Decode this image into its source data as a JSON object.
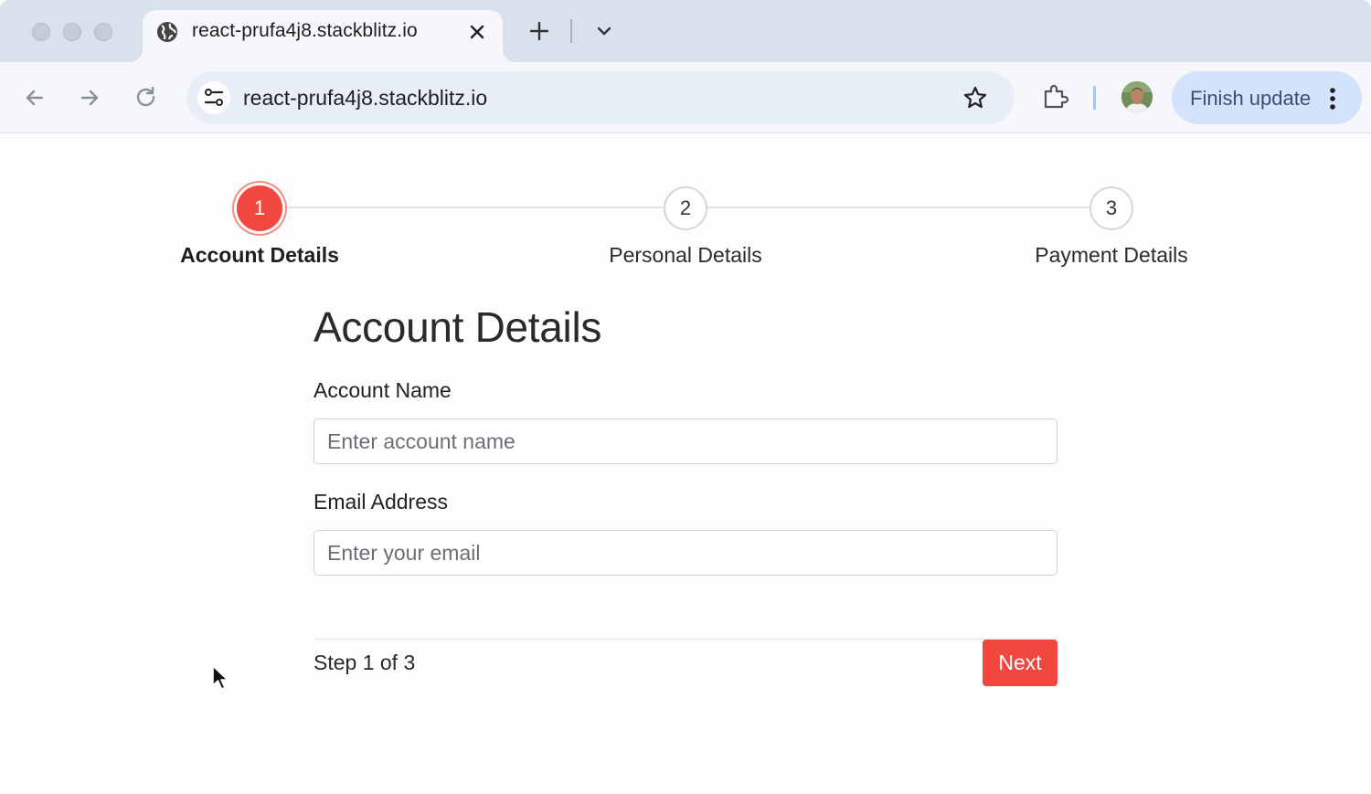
{
  "browser": {
    "tab": {
      "title": "react-prufa4j8.stackblitz.io"
    },
    "address_bar": {
      "url": "react-prufa4j8.stackblitz.io"
    },
    "update_button": {
      "label": "Finish update"
    },
    "colors": {
      "toolbar": "#f5f7fb",
      "tabstrip": "#d9e1ec",
      "update": "#d3e3fd"
    }
  },
  "stepper": {
    "active_step": 1,
    "steps": [
      {
        "number": "1",
        "label": "Account Details"
      },
      {
        "number": "2",
        "label": "Personal Details"
      },
      {
        "number": "3",
        "label": "Payment Details"
      }
    ]
  },
  "form": {
    "title": "Account Details",
    "fields": [
      {
        "label": "Account Name",
        "placeholder": "Enter account name",
        "value": ""
      },
      {
        "label": "Email Address",
        "placeholder": "Enter your email",
        "value": ""
      }
    ]
  },
  "footer": {
    "step_text": "Step 1 of 3",
    "next_label": "Next"
  },
  "colors": {
    "accent": "#f2473f"
  },
  "icons": [
    "globe-icon",
    "close-icon",
    "plus-icon",
    "chevron-down-icon",
    "back-icon",
    "forward-icon",
    "reload-icon",
    "site-settings-icon",
    "star-icon",
    "extensions-icon",
    "kebab-icon",
    "cursor-icon"
  ]
}
